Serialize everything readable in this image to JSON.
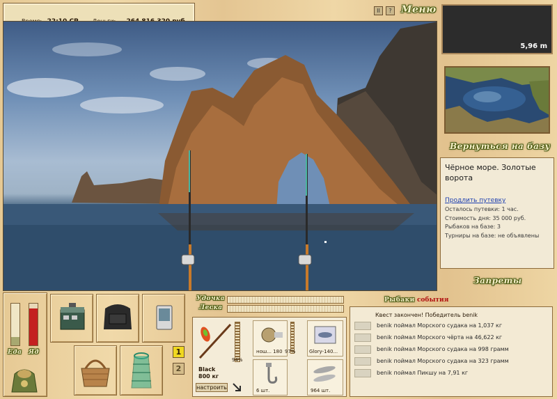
{
  "top": {
    "time_label": "Время:",
    "time_value": "22:10 СР",
    "money_label": "Деньги:",
    "money_value": "264 816 320 руб.",
    "menu_label": "Меню",
    "pause_icon": "pause-icon",
    "help_label": "?"
  },
  "depth": {
    "value": "5,96 m"
  },
  "sidebar": {
    "back_label": "Вернуться на базу",
    "location_name": "Чёрное море. Золотые ворота",
    "extend_link": "Продлить путевку",
    "info": [
      "Осталось путевки: 1 час.",
      "Стоимость дня: 35 000 руб.",
      "Рыбаков на базе: 3",
      "Турниры на базе: не объявлены"
    ],
    "bans_label": "Запреты"
  },
  "gauges": {
    "food_label": "Еда",
    "bait_label": "Яд"
  },
  "bars": {
    "rod_label": "Удочка",
    "line_label": "Леска"
  },
  "tackle": {
    "rod_name": "Black",
    "rod_weight": "800 кг",
    "rod_percent": "94%",
    "reel_percent": "97%",
    "line_label": "нош... 180",
    "lure_label": "Glory-140...",
    "hook_count": "6 шт.",
    "bait_count": "964 шт.",
    "setup_button": "настроить"
  },
  "slots": {
    "slot1": "1",
    "slot2": "2"
  },
  "log": {
    "header_a": "Рыбаки",
    "header_b": "события",
    "quest": "Квест закончен! Победитель benik",
    "entries": [
      "benik поймал Морского судака на 1,037 кг",
      "benik поймал Морского чёрта на 46,622 кг",
      "benik поймал Морского судака на 998 грамм",
      "benik поймал Морского судака на 323 грамм",
      "benik поймал Пикшу на 7,91 кг"
    ]
  },
  "colors": {
    "accent_green": "#4a5a10",
    "log_red": "#b01010",
    "link_blue": "#1d3fb0"
  }
}
